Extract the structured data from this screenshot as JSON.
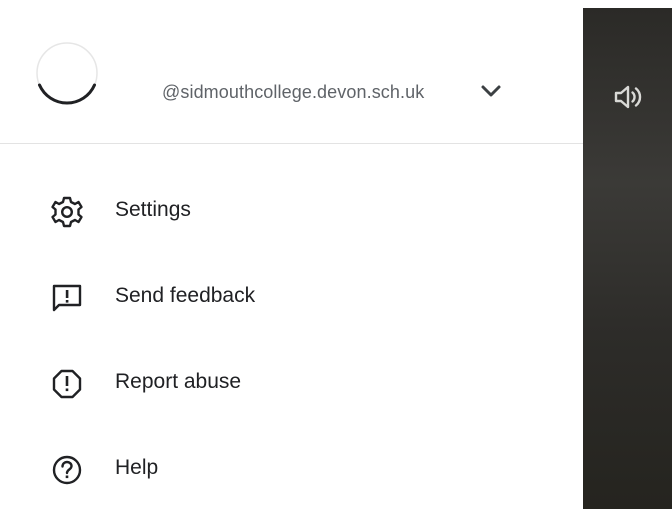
{
  "account": {
    "email": "@sidmouthcollege.devon.sch.uk",
    "avatar_icon": "loading-spinner-icon",
    "switch_icon": "chevron-down-icon"
  },
  "menu": {
    "items": [
      {
        "label": "Settings",
        "icon": "gear-icon"
      },
      {
        "label": "Send feedback",
        "icon": "feedback-icon"
      },
      {
        "label": "Report abuse",
        "icon": "report-icon"
      },
      {
        "label": "Help",
        "icon": "help-icon"
      }
    ]
  },
  "player": {
    "volume_icon": "volume-icon"
  },
  "colors": {
    "text_primary": "#202124",
    "text_secondary": "#5f6368",
    "divider": "#e3e3e3",
    "video_background": "#33322f"
  }
}
